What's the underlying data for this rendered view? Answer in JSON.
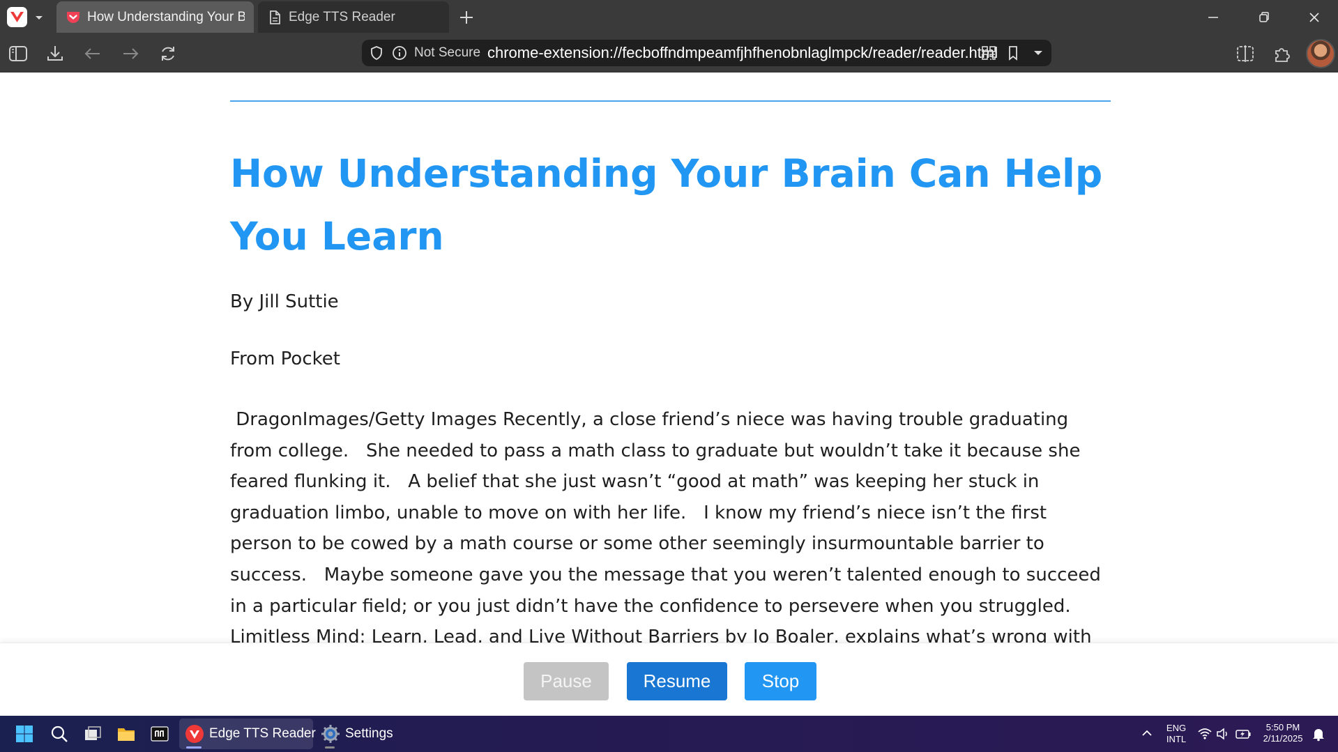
{
  "browser": {
    "tabs": [
      {
        "title": "How Understanding Your Brain Can Help You Learn",
        "active": true,
        "icon": "pocket-icon"
      },
      {
        "title": "Edge TTS Reader",
        "active": false,
        "icon": "page-icon"
      }
    ],
    "security_label": "Not Secure",
    "url": "chrome-extension://fecboffndmpeamfjhfhenobnlaglmpck/reader/reader.html"
  },
  "article": {
    "title": "How Understanding Your Brain Can Help You Learn",
    "byline": "By Jill Suttie",
    "source": "From Pocket",
    "body": " DragonImages/Getty Images Recently, a close friend’s niece was having trouble graduating from college.   She needed to pass a math class to graduate but wouldn’t take it because she feared flunking it.   A belief that she just wasn’t “good at math” was keeping her stuck in graduation limbo, unable to move on with her life.   I know my friend’s niece isn’t the first person to be cowed by a math course or some other seemingly insurmountable barrier to success.   Maybe someone gave you the message that you weren’t talented enough to succeed in a particular field; or you just didn’t have the confidence to persevere when you struggled.   Limitless Mind: Learn, Lead, and Live Without Barriers by Jo Boaler, explains what’s wrong with this attitude.   Boaler, a Stanford University math professor, argues that"
  },
  "controls": {
    "pause_label": "Pause",
    "resume_label": "Resume",
    "stop_label": "Stop",
    "pause_enabled": false
  },
  "taskbar": {
    "apps": [
      {
        "label": "Edge TTS Reader",
        "icon": "vivaldi-icon",
        "active": true
      },
      {
        "label": "Settings",
        "icon": "settings-gear-icon",
        "active": false
      }
    ],
    "language_line1": "ENG",
    "language_line2": "INTL",
    "time": "5:50 PM",
    "date": "2/11/2025"
  },
  "colors": {
    "accent": "#2196f3",
    "resume_button": "#1976d2",
    "disabled_button": "#c4c4c4",
    "browser_chrome": "#3a3a3a"
  }
}
